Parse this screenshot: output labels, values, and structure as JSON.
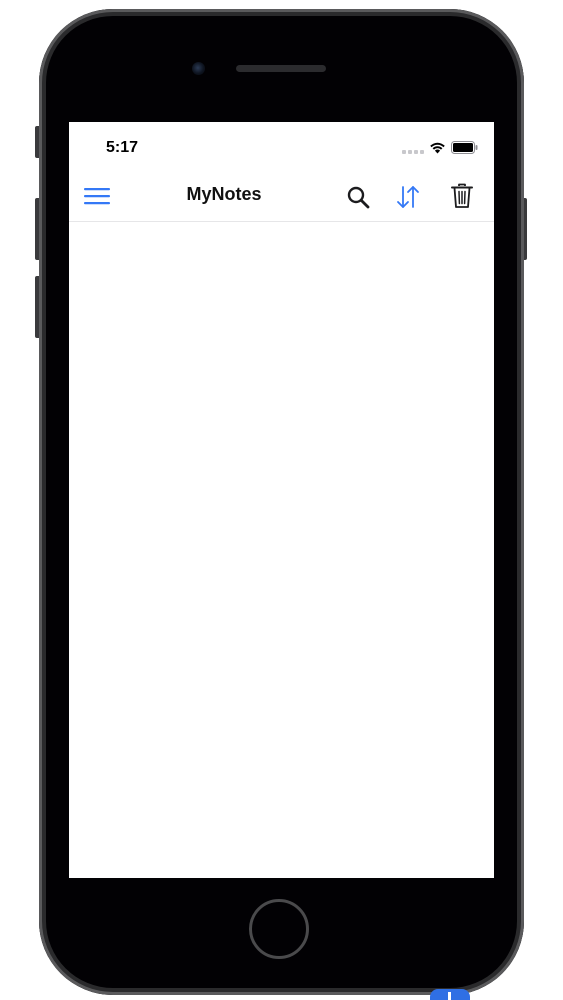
{
  "status_bar": {
    "time": "5:17"
  },
  "nav_bar": {
    "title": "MyNotes",
    "icons": [
      "menu-icon",
      "search-icon",
      "sort-icon",
      "trash-icon"
    ]
  },
  "colors": {
    "accent": "#3478f6",
    "text": "#111111",
    "device_body": "#020104"
  }
}
